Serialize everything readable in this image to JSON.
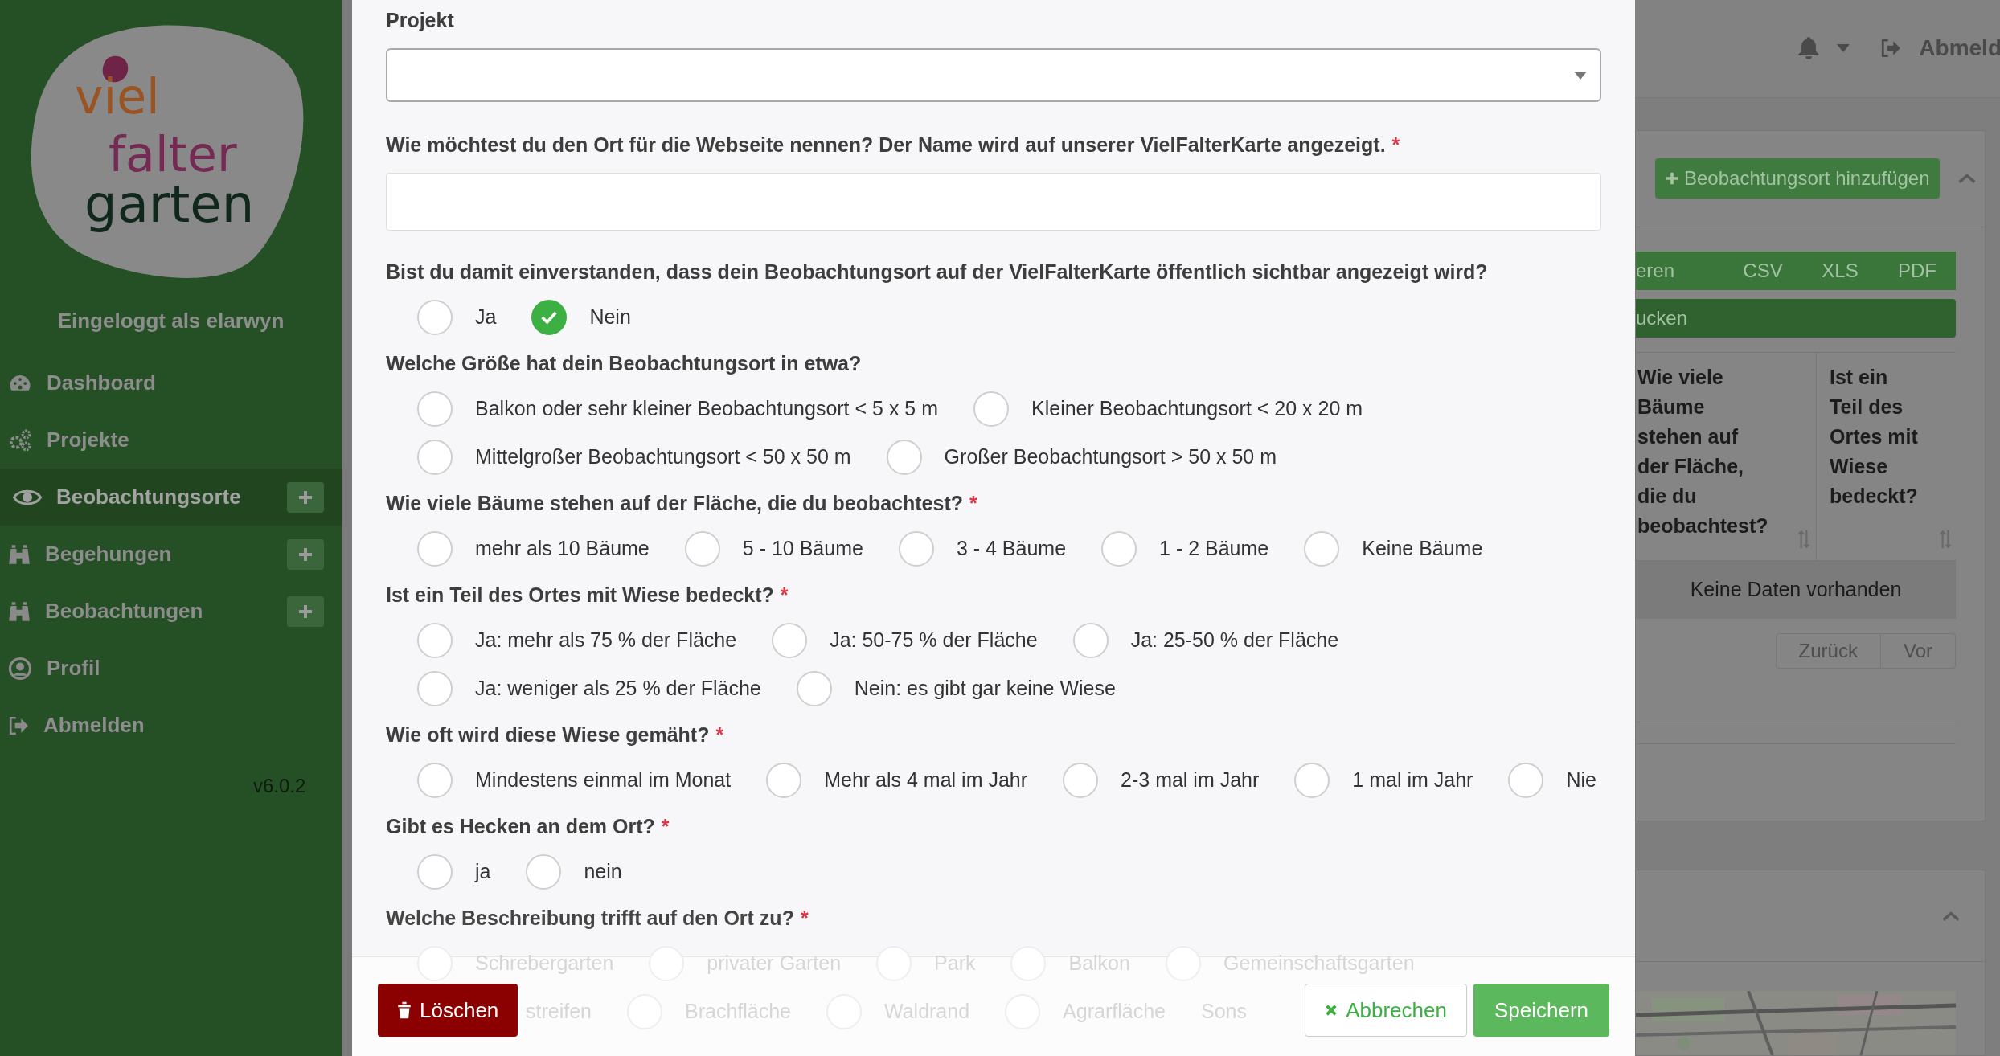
{
  "sidebar": {
    "logo": {
      "lines": [
        "viel",
        "falter",
        "garten"
      ]
    },
    "user_label": "Eingeloggt als elarwyn",
    "items": [
      {
        "label": "Dashboard",
        "selected": false,
        "has_add": false
      },
      {
        "label": "Projekte",
        "selected": false,
        "has_add": false
      },
      {
        "label": "Beobachtungsorte",
        "selected": true,
        "has_add": true
      },
      {
        "label": "Begehungen",
        "selected": false,
        "has_add": true
      },
      {
        "label": "Beobachtungen",
        "selected": false,
        "has_add": true
      },
      {
        "label": "Profil",
        "selected": false,
        "has_add": false
      },
      {
        "label": "Abmelden",
        "selected": false,
        "has_add": false
      }
    ],
    "version": "v6.0.2"
  },
  "header": {
    "logout_label": "Abmeld"
  },
  "background_list": {
    "add_button": "Beobachtungsort hinzufügen",
    "export_buttons": [
      "eren",
      "CSV",
      "XLS",
      "PDF"
    ],
    "print_button": "ucken",
    "columns": [
      "Wie viele Bäume stehen auf der Fläche, die du beobachtest?",
      "Ist ein Teil des Ortes mit Wiese bedeckt?"
    ],
    "empty_text": "Keine Daten vorhanden",
    "pagination": [
      "Zurück",
      "Vor"
    ]
  },
  "modal": {
    "fields": [
      {
        "kind": "select",
        "label": "Projekt"
      },
      {
        "kind": "text",
        "label": "Wie möchtest du den Ort für die Webseite nennen? Der Name wird auf unserer VielFalterKarte angezeigt.",
        "required_mark": "*"
      },
      {
        "kind": "radio",
        "label": "Bist du damit einverstanden, dass dein Beobachtungsort auf der VielFalterKarte öffentlich sichtbar angezeigt wird?",
        "rows": [
          [
            {
              "label": "Ja",
              "selected": false
            },
            {
              "label": "Nein",
              "selected": true
            }
          ]
        ]
      },
      {
        "kind": "radio",
        "label": "Welche Größe hat dein Beobachtungsort in etwa?",
        "rows": [
          [
            {
              "label": "Balkon oder sehr kleiner Beobachtungsort < 5 x 5 m",
              "selected": false
            },
            {
              "label": "Kleiner Beobachtungsort < 20 x 20 m",
              "selected": false
            }
          ],
          [
            {
              "label": "Mittelgroßer Beobachtungsort < 50 x 50 m",
              "selected": false
            },
            {
              "label": "Großer Beobachtungsort > 50 x 50 m",
              "selected": false
            }
          ]
        ]
      },
      {
        "kind": "radio",
        "label": "Wie viele Bäume stehen auf der Fläche, die du beobachtest?",
        "required_mark": "*",
        "rows": [
          [
            {
              "label": "mehr als 10 Bäume",
              "selected": false
            },
            {
              "label": "5 - 10 Bäume",
              "selected": false
            },
            {
              "label": "3 - 4 Bäume",
              "selected": false
            },
            {
              "label": "1 - 2 Bäume",
              "selected": false
            },
            {
              "label": "Keine Bäume",
              "selected": false
            }
          ]
        ]
      },
      {
        "kind": "radio",
        "label": "Ist ein Teil des Ortes mit Wiese bedeckt?",
        "required_mark": "*",
        "rows": [
          [
            {
              "label": "Ja: mehr als 75 % der Fläche",
              "selected": false
            },
            {
              "label": "Ja: 50-75 % der Fläche",
              "selected": false
            },
            {
              "label": "Ja: 25-50 % der Fläche",
              "selected": false
            }
          ],
          [
            {
              "label": "Ja: weniger als 25 % der Fläche",
              "selected": false
            },
            {
              "label": "Nein: es gibt gar keine Wiese",
              "selected": false
            }
          ]
        ]
      },
      {
        "kind": "radio",
        "label": "Wie oft wird diese Wiese gemäht?",
        "required_mark": "*",
        "rows": [
          [
            {
              "label": "Mindestens einmal im Monat",
              "selected": false
            },
            {
              "label": "Mehr als 4 mal im Jahr",
              "selected": false
            },
            {
              "label": "2-3 mal im Jahr",
              "selected": false
            },
            {
              "label": "1 mal im Jahr",
              "selected": false
            },
            {
              "label": "Nie",
              "selected": false
            }
          ]
        ]
      },
      {
        "kind": "radio",
        "label": "Gibt es Hecken an dem Ort?",
        "required_mark": "*",
        "rows": [
          [
            {
              "label": "ja",
              "selected": false
            },
            {
              "label": "nein",
              "selected": false
            }
          ]
        ]
      },
      {
        "kind": "radio",
        "label": "Welche Beschreibung trifft auf den Ort zu?",
        "required_mark": "*",
        "faded": true,
        "rows": [
          [
            {
              "label": "Schrebergarten",
              "selected": false
            },
            {
              "label": "privater Garten",
              "selected": false
            },
            {
              "label": "Park",
              "selected": false
            },
            {
              "label": "Balkon",
              "selected": false
            },
            {
              "label": "Gemeinschaftsgarten",
              "selected": false
            }
          ],
          [
            {
              "label": "streifen",
              "kind": "clipped"
            },
            {
              "label": "Brachfläche",
              "selected": false
            },
            {
              "label": "Waldrand",
              "selected": false
            },
            {
              "label": "Agrarfläche",
              "selected": false
            },
            {
              "label": "Sons",
              "kind": "clipped"
            }
          ]
        ]
      }
    ],
    "footer": {
      "delete": "Löschen",
      "cancel": "Abbrechen",
      "save": "Speichern"
    }
  }
}
